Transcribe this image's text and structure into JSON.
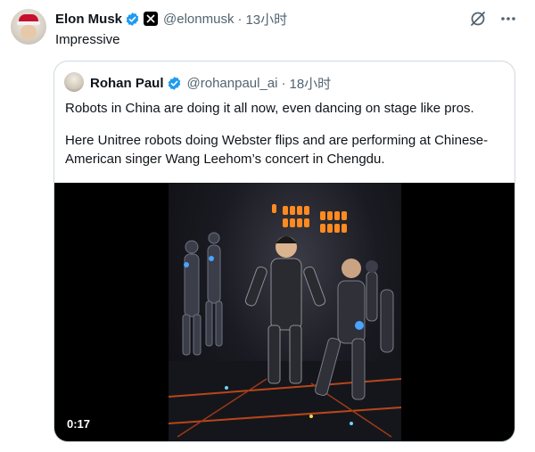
{
  "tweet": {
    "author_name": "Elon Musk",
    "author_handle": "@elonmusk",
    "separator": "·",
    "time": "13小时",
    "text": "Impressive"
  },
  "quoted_tweet": {
    "author_name": "Rohan Paul",
    "author_handle": "@rohanpaul_ai",
    "separator": "·",
    "time": "18小时",
    "paragraphs": [
      "Robots in China are doing it all now, even dancing on stage like pros.",
      "Here Unitree robots doing Webster flips and are performing at Chinese-American singer Wang Leehom’s concert in Chengdu."
    ],
    "video": {
      "duration": "0:17"
    }
  },
  "colors": {
    "verified": "#1d9bf0",
    "secondary_text": "#536471",
    "border": "#cfd9de",
    "stage_lights": "#ff8a1f"
  },
  "icons": [
    "verified-badge-icon",
    "x-logo-icon",
    "grok-icon",
    "more-options-icon"
  ]
}
